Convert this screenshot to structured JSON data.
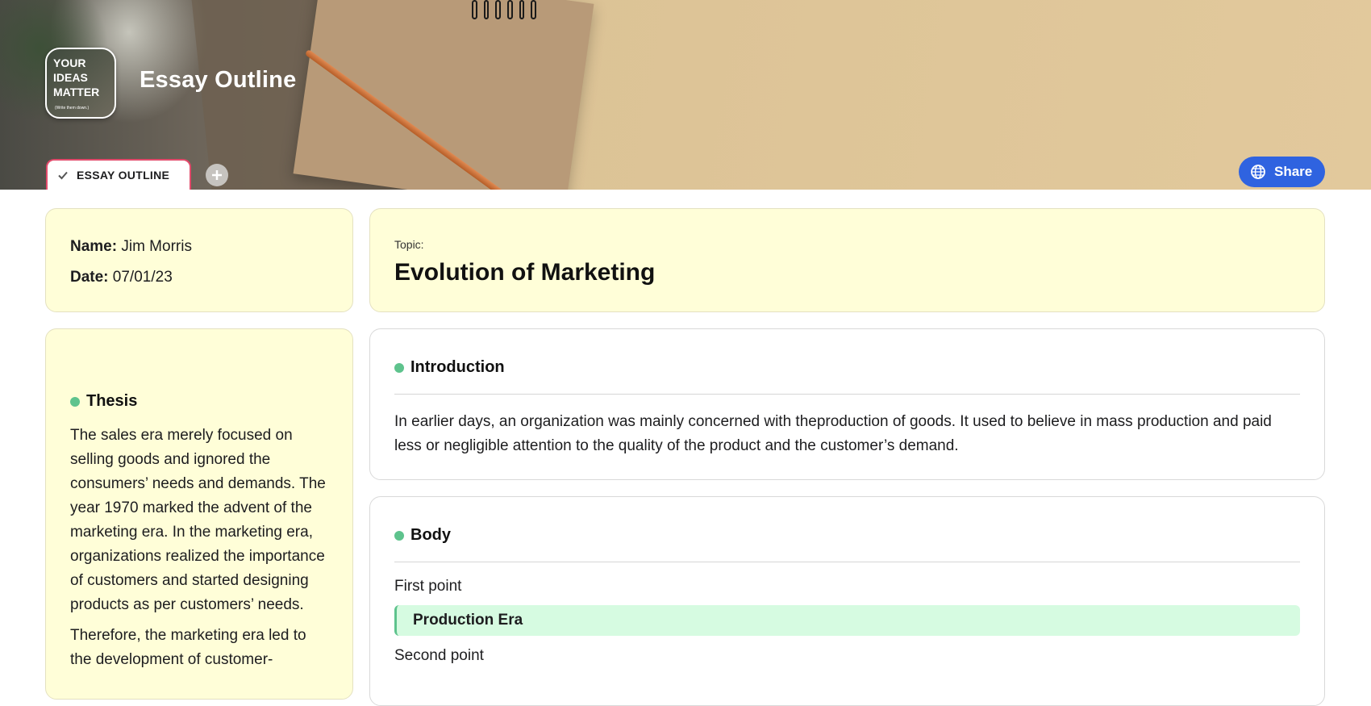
{
  "header": {
    "title": "Essay Outline",
    "logo_text": [
      "YOUR",
      "IDEAS",
      "MATTER",
      "(Write them down.)"
    ],
    "tab_label": "ESSAY OUTLINE",
    "share_label": "Share"
  },
  "meta": {
    "name_label": "Name:",
    "name_value": "Jim Morris",
    "date_label": "Date:",
    "date_value": "07/01/23"
  },
  "topic": {
    "label": "Topic:",
    "value": "Evolution of Marketing"
  },
  "thesis": {
    "heading": "Thesis",
    "paragraph1": "The sales era merely focused on selling goods and ignored the consumers’ needs and demands. The year 1970 marked the advent of the marketing era. In the marketing era, organizations realized the importance of customers and started designing products as per customers’ needs.",
    "paragraph2": "Therefore, the marketing era led to the development of customer-"
  },
  "introduction": {
    "heading": "Introduction",
    "text": "In earlier days, an organization was mainly concerned with theproduction of goods. It used to believe in mass production and paid less or negligible attention to the quality of the product and the customer’s demand."
  },
  "body": {
    "heading": "Body",
    "first_label": "First point",
    "first_value": "Production Era",
    "second_label": "Second point"
  },
  "colors": {
    "accent_dot": "#5ec38d",
    "tab_border": "#e24a6b",
    "share_button": "#2f63e0",
    "card_yellow": "#fffed8",
    "point_highlight": "#d6fbe1"
  },
  "icons": [
    "check-icon",
    "plus-icon",
    "globe-icon"
  ]
}
